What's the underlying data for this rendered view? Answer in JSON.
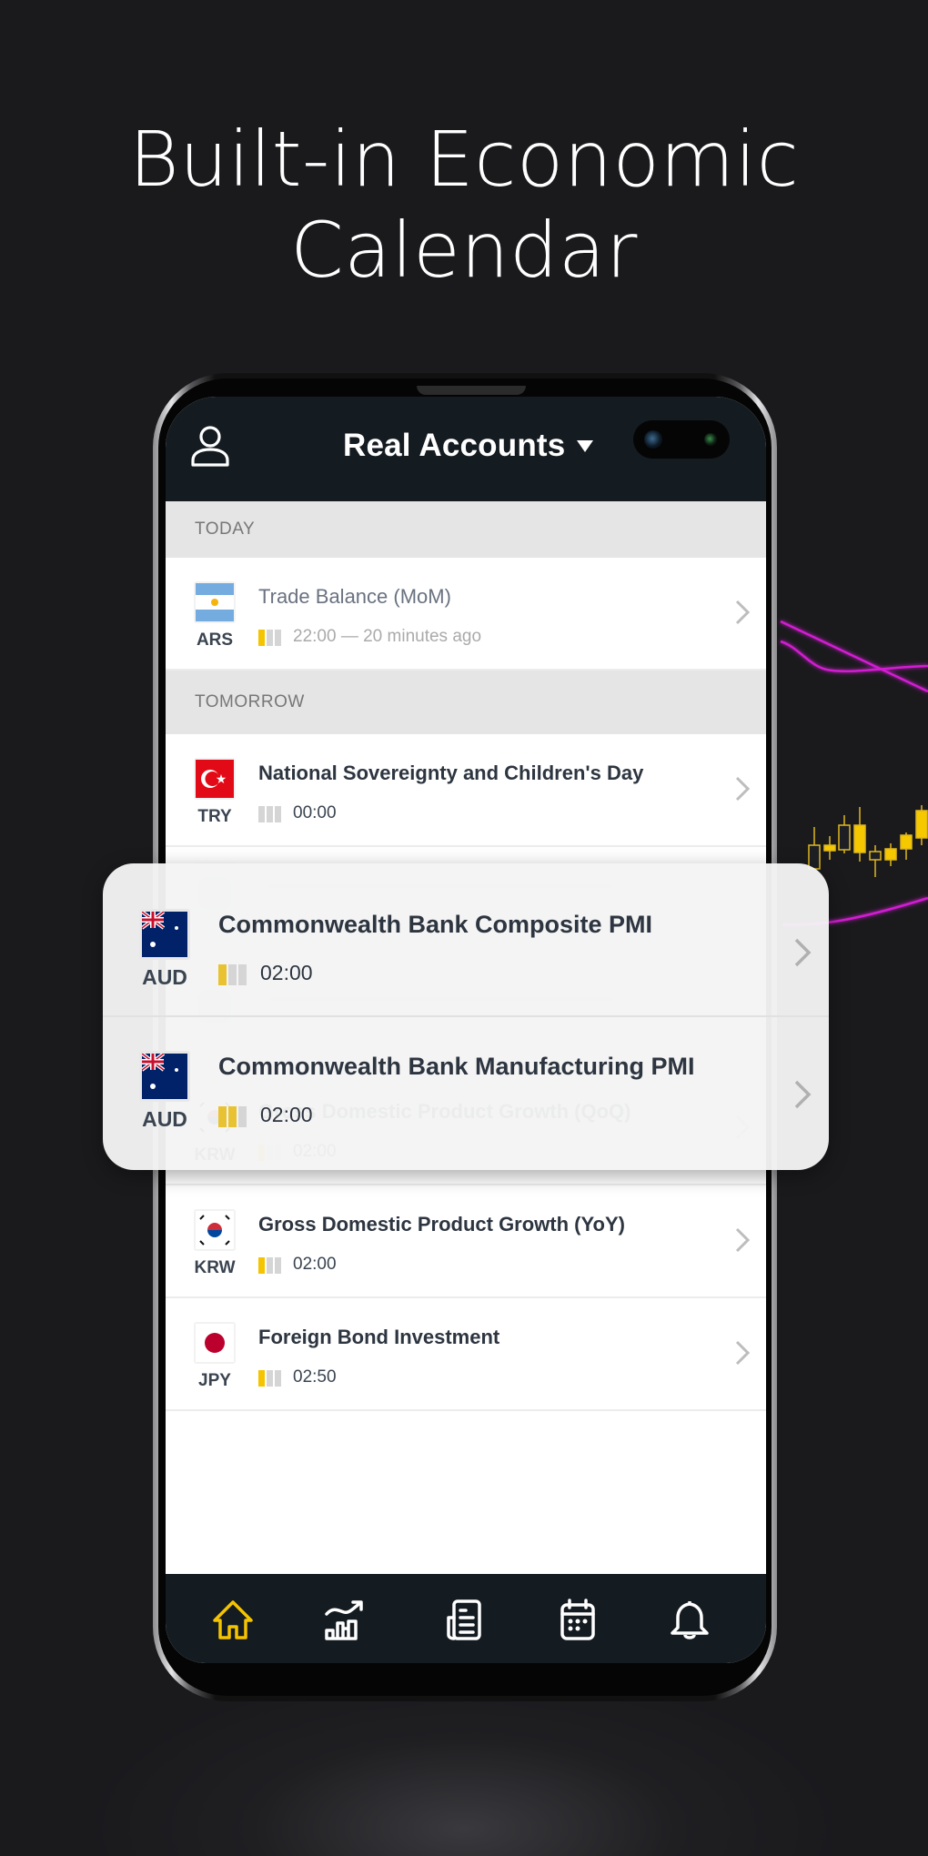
{
  "headline": {
    "line1": "Built-in Economic",
    "line2": "Calendar"
  },
  "header": {
    "title": "Real Accounts",
    "left_icon": "user-icon",
    "dropdown_icon": "caret-down-icon"
  },
  "sections": [
    {
      "label": "TODAY",
      "events": [
        {
          "currency": "ARS",
          "flag": "argentina-flag-icon",
          "title": "Trade Balance (MoM)",
          "time": "22:00 — 20 minutes ago",
          "impact": 1,
          "past": true
        }
      ]
    },
    {
      "label": "TOMORROW",
      "events": [
        {
          "currency": "TRY",
          "flag": "turkey-flag-icon",
          "title": "National Sovereignty and Children's Day",
          "time": "00:00",
          "impact": 0,
          "past": false
        },
        {
          "currency": "KRW",
          "flag": "south-korea-flag-icon",
          "title": "Gross Domestic Product Growth (QoQ)",
          "time": "02:00",
          "impact": 1,
          "past": false
        },
        {
          "currency": "KRW",
          "flag": "south-korea-flag-icon",
          "title": "Gross Domestic Product Growth (YoY)",
          "time": "02:00",
          "impact": 1,
          "past": false
        },
        {
          "currency": "JPY",
          "flag": "japan-flag-icon",
          "title": "Foreign Bond Investment",
          "time": "02:50",
          "impact": 1,
          "past": false
        }
      ]
    }
  ],
  "popup": {
    "events": [
      {
        "currency": "AUD",
        "flag": "australia-flag-icon",
        "title": "Commonwealth Bank Composite PMI",
        "time": "02:00",
        "impact": 1
      },
      {
        "currency": "AUD",
        "flag": "australia-flag-icon",
        "title": "Commonwealth Bank Manufacturing PMI",
        "time": "02:00",
        "impact": 2
      }
    ]
  },
  "bottom_nav": {
    "items": [
      {
        "icon": "home-icon",
        "active": true
      },
      {
        "icon": "markets-chart-icon",
        "active": false
      },
      {
        "icon": "news-icon",
        "active": false
      },
      {
        "icon": "calendar-icon",
        "active": false
      },
      {
        "icon": "bell-icon",
        "active": false
      }
    ]
  },
  "colors": {
    "accent": "#f5c400",
    "topbar_bg": "#141b21",
    "section_bg": "#e5e5e5",
    "chart_line": "#d21fd2"
  }
}
